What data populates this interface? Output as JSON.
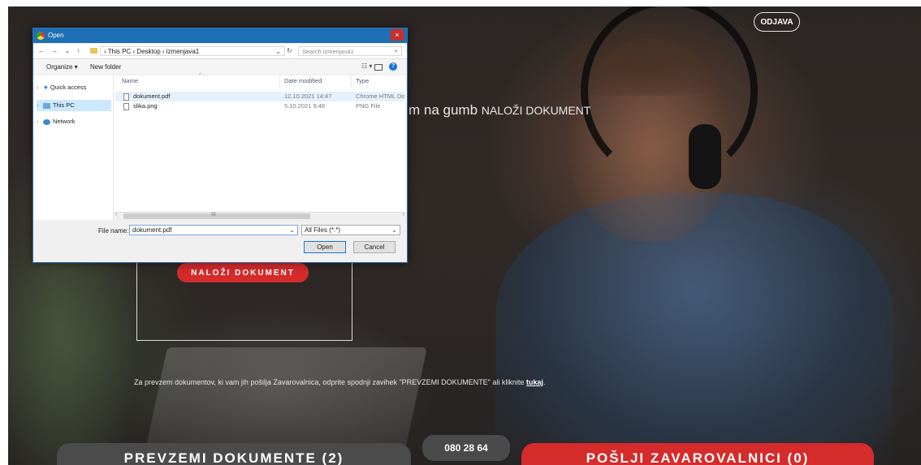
{
  "header": {
    "logout_label": "ODJAVA"
  },
  "main": {
    "instruction_text": "m na gumb",
    "instruction_bold": "NALOŽI DOKUMENT",
    "upload_button_label": "NALOŽI DOKUMENT",
    "info_text": "Za prevzem dokumentov, ki vam jih pošilja Zavarovalnica, odprite spodnji zavihek \"PREVZEMI DOKUMENTE\" ali kliknite",
    "info_link": "tukaj",
    "info_period": "."
  },
  "footer": {
    "download_button_label": "PREVZEMI DOKUMENTE (2)",
    "phone": "080 28 64",
    "send_button_label": "POŠLJI ZAVAROVALNICI (0)"
  },
  "dialog": {
    "title": "Open",
    "close_glyph": "×",
    "nav_arrows": "← → ⌄ ↑",
    "address": "› This PC › Desktop › izmenjava1",
    "address_chevron": "⌄",
    "refresh_glyph": "↻",
    "search_placeholder": "Search izmenjava1",
    "search_glyph": "⌕",
    "organize_label": "Organize ▾",
    "new_folder_label": "New folder",
    "view_glyph": "☷ ▾",
    "help_glyph": "?",
    "nav_items": [
      {
        "expand": "›",
        "label": "Quick access",
        "icon": "star-icon"
      },
      {
        "expand": "›",
        "label": "This PC",
        "icon": "computer-icon"
      },
      {
        "expand": "›",
        "label": "Network",
        "icon": "network-icon"
      }
    ],
    "star_glyph": "★",
    "columns": {
      "name": "Name",
      "date": "Date modified",
      "type": "Type",
      "sort_glyph": "^"
    },
    "files": [
      {
        "name": "dokument.pdf",
        "date": "12.10.2021 14:47",
        "type": "Chrome HTML Document"
      },
      {
        "name": "slika.png",
        "date": "5.10.2021 9:48",
        "type": "PNG File"
      }
    ],
    "scroll_left": "‹",
    "scroll_right": "›",
    "scroll_grip": "III",
    "file_name_label": "File name:",
    "file_name_value": "dokument.pdf",
    "file_name_chevron": "⌄",
    "filter_value": "All Files (*.*)",
    "filter_chevron": "⌄",
    "open_label": "Open",
    "cancel_label": "Cancel"
  },
  "colors": {
    "accent_red": "#d52b2b",
    "dark_button": "#4b4b4b",
    "dialog_titlebar": "#1f6fb4"
  }
}
